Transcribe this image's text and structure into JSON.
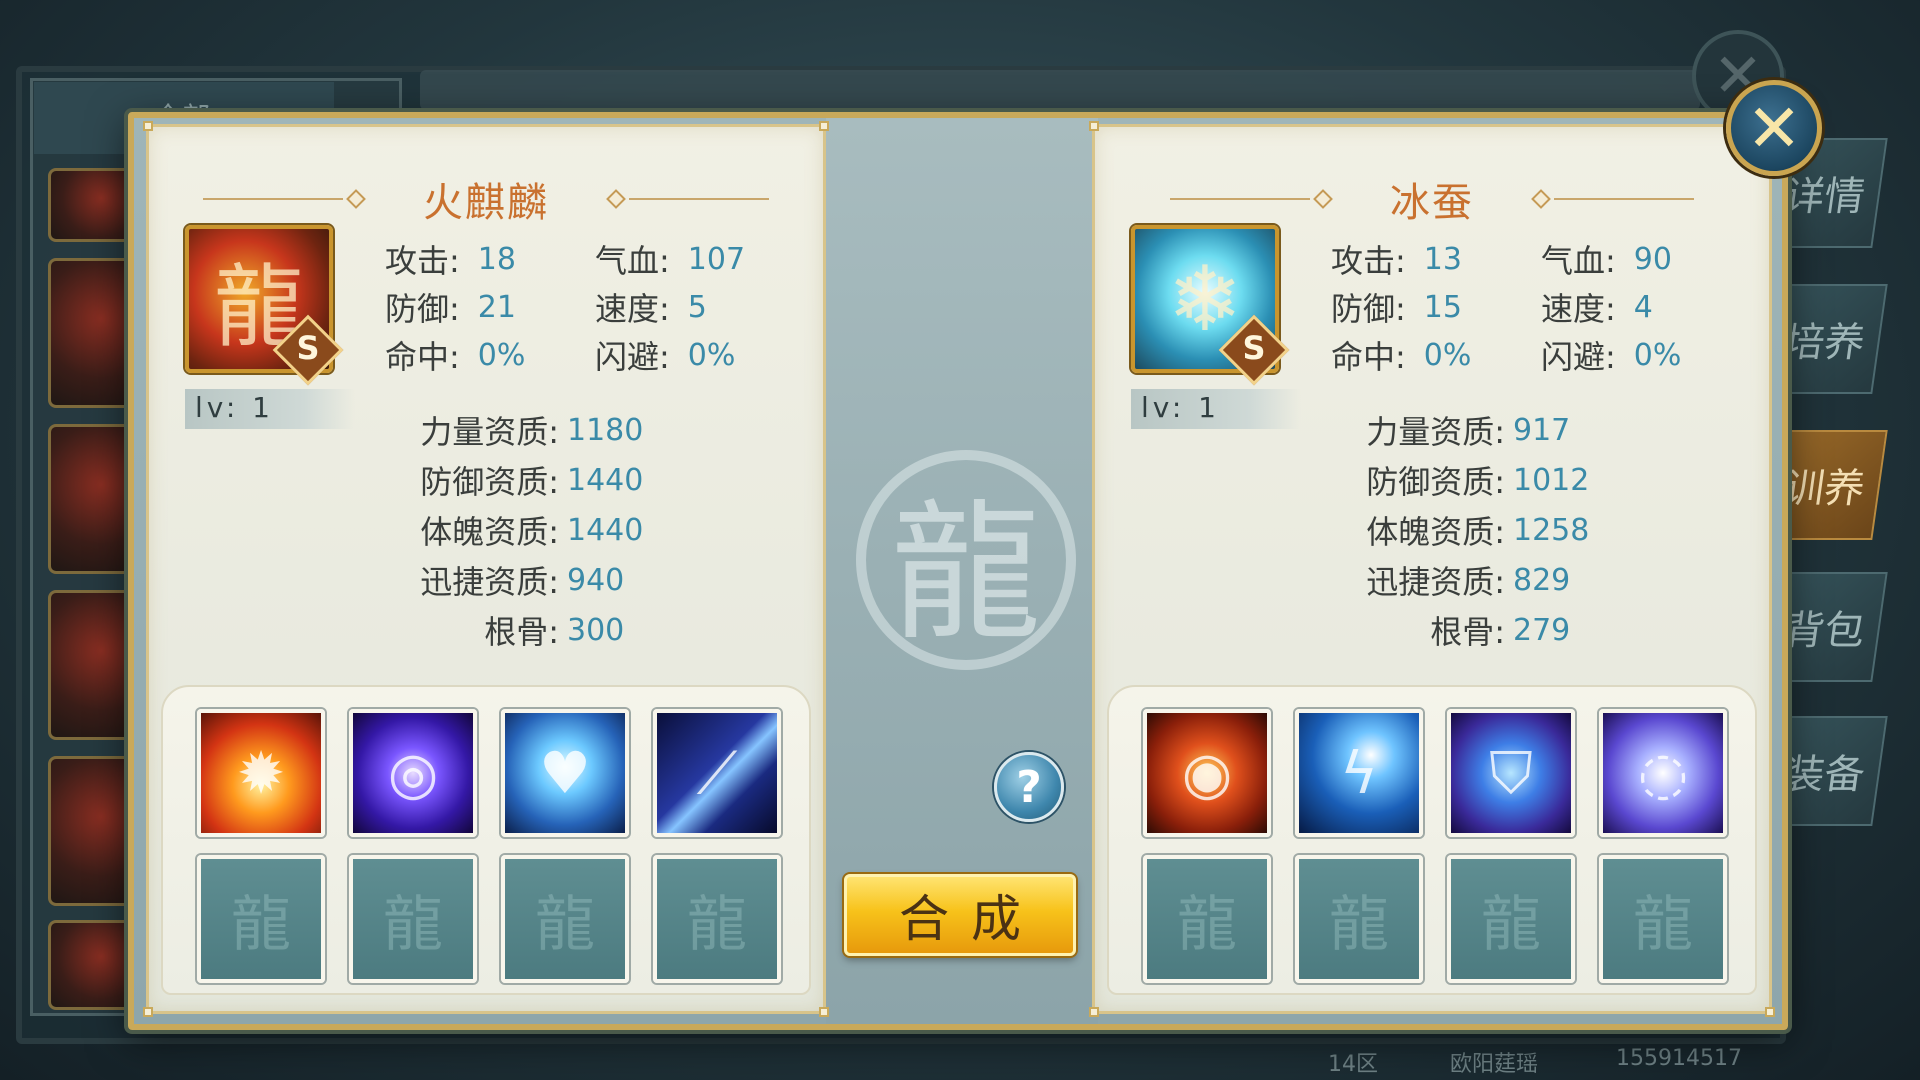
{
  "background": {
    "list_header": "全部",
    "tabs": [
      "详情",
      "培养",
      "训养",
      "背包",
      "装备"
    ],
    "active_tab_index": 2,
    "footer": {
      "server": "14区",
      "player": "欧阳莛瑶",
      "id": "155914517"
    }
  },
  "left_pet": {
    "name": "火麒麟",
    "rank": "S",
    "level": "lv: 1",
    "stats": [
      {
        "label": "攻击:",
        "value": "18"
      },
      {
        "label": "气血:",
        "value": "107"
      },
      {
        "label": "防御:",
        "value": "21"
      },
      {
        "label": "速度:",
        "value": "5"
      },
      {
        "label": "命中:",
        "value": "0%"
      },
      {
        "label": "闪避:",
        "value": "0%"
      }
    ],
    "aptitudes": [
      {
        "label": "力量资质:",
        "value": "1180"
      },
      {
        "label": "防御资质:",
        "value": "1440"
      },
      {
        "label": "体魄资质:",
        "value": "1440"
      },
      {
        "label": "迅捷资质:",
        "value": "940"
      },
      {
        "label": "根骨:",
        "value": "300"
      }
    ],
    "skills": [
      "flame-burst-skill-icon",
      "purple-vortex-skill-icon",
      "water-heart-skill-icon",
      "claw-slash-skill-icon"
    ]
  },
  "right_pet": {
    "name": "冰蚕",
    "rank": "S",
    "level": "lv: 1",
    "stats": [
      {
        "label": "攻击:",
        "value": "13"
      },
      {
        "label": "气血:",
        "value": "90"
      },
      {
        "label": "防御:",
        "value": "15"
      },
      {
        "label": "速度:",
        "value": "4"
      },
      {
        "label": "命中:",
        "value": "0%"
      },
      {
        "label": "闪避:",
        "value": "0%"
      }
    ],
    "aptitudes": [
      {
        "label": "力量资质:",
        "value": "917"
      },
      {
        "label": "防御资质:",
        "value": "1012"
      },
      {
        "label": "体魄资质:",
        "value": "1258"
      },
      {
        "label": "迅捷资质:",
        "value": "829"
      },
      {
        "label": "根骨:",
        "value": "279"
      }
    ],
    "skills": [
      "lava-orb-skill-icon",
      "lightning-storm-skill-icon",
      "blue-shield-skill-icon",
      "spirit-orb-skill-icon"
    ]
  },
  "actions": {
    "compose_label": "合成",
    "help_label": "?",
    "close_label": "✕"
  },
  "colors": {
    "name_color": "#c9712f",
    "value_color": "#3a8aa8",
    "button_gold": "#f7c21a"
  }
}
